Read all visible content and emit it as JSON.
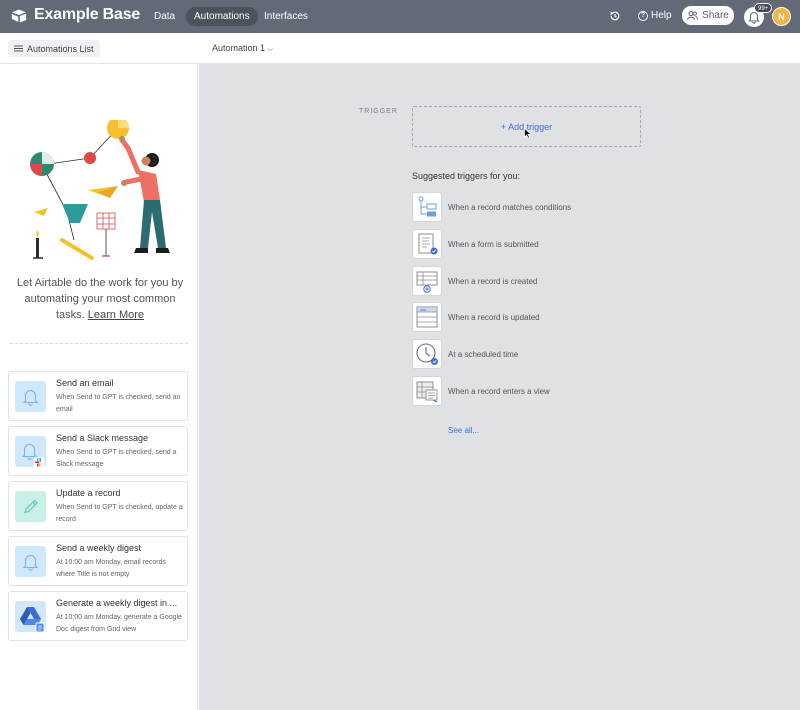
{
  "header": {
    "base_name": "Example Base",
    "tabs": [
      {
        "label": "Data"
      },
      {
        "label": "Automations"
      },
      {
        "label": "Interfaces"
      }
    ],
    "help_label": "Help",
    "share_label": "Share",
    "notification_badge": "99+",
    "avatar_initial": "N"
  },
  "toolbar": {
    "list_label": "Automations List",
    "automation_name": "Automation 1"
  },
  "sidebar": {
    "intro_text": "Let Airtable do the work for you by automating your most common tasks.",
    "learn_more": "Learn More",
    "cards": [
      {
        "title": "Send an email",
        "desc": "When Send to GPT is checked, send an email",
        "icon": "bell-icon"
      },
      {
        "title": "Send a Slack message",
        "desc": "When Send to GPT is checked, send a Slack message",
        "icon": "bell-slack-icon"
      },
      {
        "title": "Update a record",
        "desc": "When Send to GPT is checked, update a record",
        "icon": "pencil-icon"
      },
      {
        "title": "Send a weekly digest",
        "desc": "At 10:00 am Monday, email records where Title is not empty",
        "icon": "bell-icon"
      },
      {
        "title": "Generate a weekly digest in ...",
        "desc": "At 10:00 am Monday, generate a Google Doc digest from Grid view",
        "icon": "google-drive-icon"
      }
    ]
  },
  "main": {
    "trigger_label": "TRIGGER",
    "add_trigger": "+ Add trigger",
    "suggested_label": "Suggested triggers for you:",
    "triggers": [
      {
        "label": "When a record matches conditions",
        "icon": "conditions-icon"
      },
      {
        "label": "When a form is submitted",
        "icon": "form-icon"
      },
      {
        "label": "When a record is created",
        "icon": "record-created-icon"
      },
      {
        "label": "When a record is updated",
        "icon": "record-updated-icon"
      },
      {
        "label": "At a scheduled time",
        "icon": "clock-icon"
      },
      {
        "label": "When a record enters a view",
        "icon": "view-icon"
      }
    ],
    "see_all": "See all..."
  },
  "colors": {
    "topbar": "#636976",
    "main_bg": "#e0e1e5",
    "link": "#3b6fd6",
    "avatar": "#f1b64a"
  }
}
